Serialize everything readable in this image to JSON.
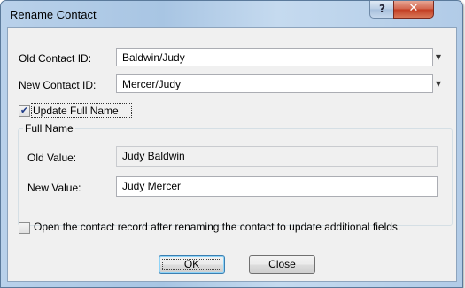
{
  "window": {
    "title": "Rename Contact",
    "help_label": "?",
    "close_label": "✕"
  },
  "old_contact": {
    "label": "Old Contact ID:",
    "value": "Baldwin/Judy"
  },
  "new_contact": {
    "label": "New Contact ID:",
    "value": "Mercer/Judy"
  },
  "update_full_name": {
    "label": "Update Full Name",
    "checked": true
  },
  "full_name_group": {
    "label": "Full Name",
    "old_value_label": "Old Value:",
    "old_value": "Judy Baldwin",
    "new_value_label": "New Value:",
    "new_value": "Judy Mercer"
  },
  "open_record": {
    "label": "Open the contact record after renaming the contact to update additional fields.",
    "checked": false
  },
  "buttons": {
    "ok": "OK",
    "close": "Close"
  },
  "icons": {
    "dropdown": "chevron-down-icon",
    "check": "checkmark-icon"
  }
}
